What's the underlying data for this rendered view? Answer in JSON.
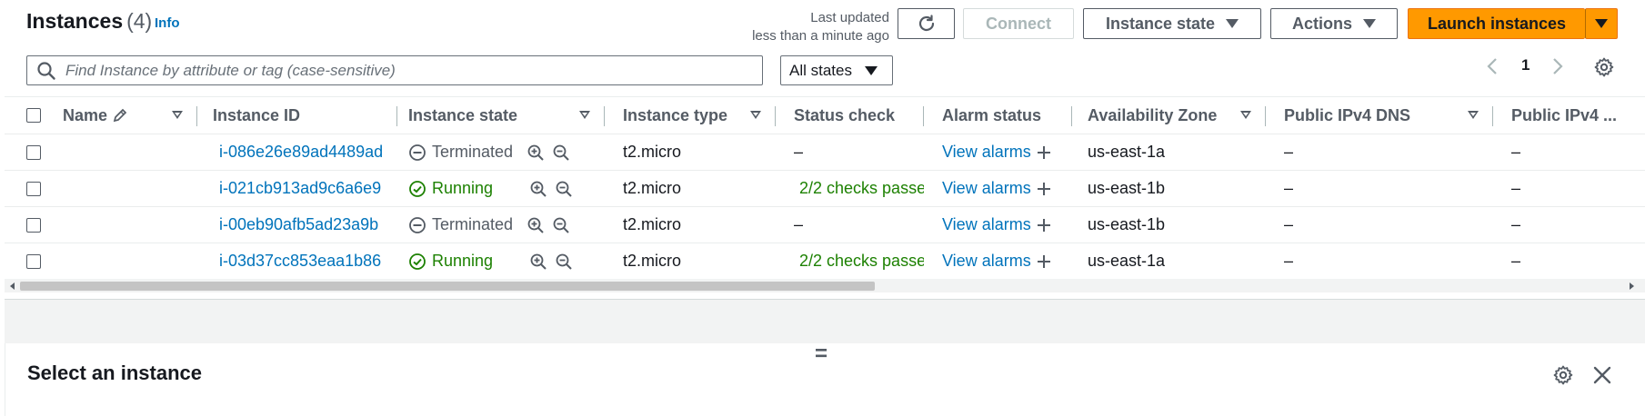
{
  "header": {
    "title": "Instances",
    "count": "(4)",
    "info": "Info",
    "last_updated_line1": "Last updated",
    "last_updated_line2": "less than a minute ago",
    "connect_label": "Connect",
    "instance_state_label": "Instance state",
    "actions_label": "Actions",
    "launch_label": "Launch instances"
  },
  "search": {
    "placeholder": "Find Instance by attribute or tag (case-sensitive)"
  },
  "filter": {
    "selected": "All states"
  },
  "pagination": {
    "current_page": "1"
  },
  "columns": [
    "Name",
    "Instance ID",
    "Instance state",
    "Instance type",
    "Status check",
    "Alarm status",
    "Availability Zone",
    "Public IPv4 DNS",
    "Public IPv4 ..."
  ],
  "rows": [
    {
      "name": "",
      "id": "i-086e26e89ad4489ad",
      "state": "Terminated",
      "type": "t2.micro",
      "status": "–",
      "alarm": "View alarms",
      "az": "us-east-1a",
      "dns": "–",
      "ip": "–"
    },
    {
      "name": "",
      "id": "i-021cb913ad9c6a6e9",
      "state": "Running",
      "type": "t2.micro",
      "status": "2/2 checks passec",
      "alarm": "View alarms",
      "az": "us-east-1b",
      "dns": "–",
      "ip": "–"
    },
    {
      "name": "",
      "id": "i-00eb90afb5ad23a9b",
      "state": "Terminated",
      "type": "t2.micro",
      "status": "–",
      "alarm": "View alarms",
      "az": "us-east-1b",
      "dns": "–",
      "ip": "–"
    },
    {
      "name": "",
      "id": "i-03d37cc853eaa1b86",
      "state": "Running",
      "type": "t2.micro",
      "status": "2/2 checks passec",
      "alarm": "View alarms",
      "az": "us-east-1a",
      "dns": "–",
      "ip": "–"
    }
  ],
  "bottom": {
    "title": "Select an instance",
    "drag_handle": "="
  },
  "colors": {
    "link": "#0073bb",
    "running": "#1d8102",
    "primary": "#ff9900"
  }
}
